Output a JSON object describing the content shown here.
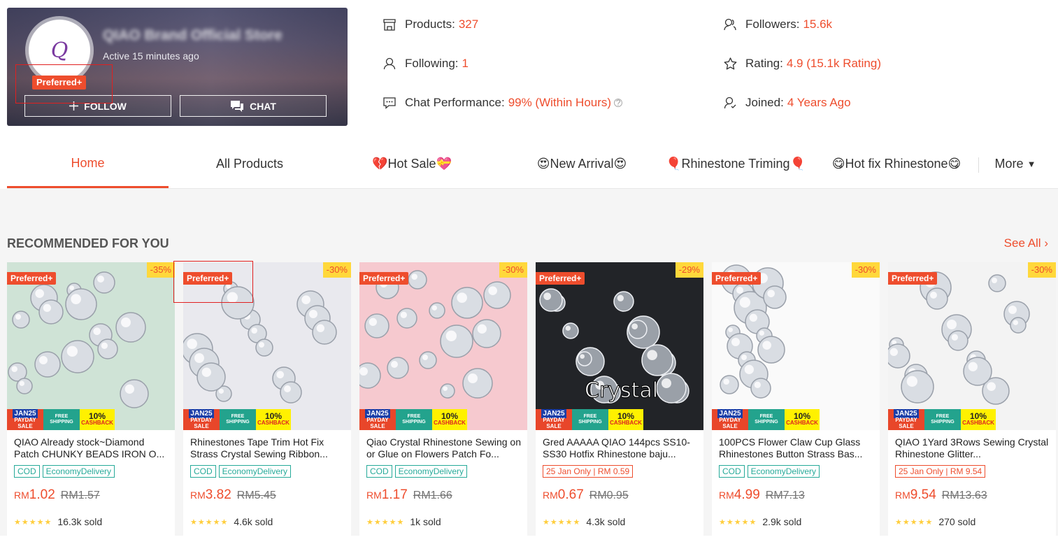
{
  "shop": {
    "name": "QIAO Brand Official Store",
    "active": "Active 15 minutes ago",
    "badge": "Preferred+",
    "follow_label": "FOLLOW",
    "chat_label": "CHAT"
  },
  "stats": {
    "products": {
      "label": "Products:",
      "value": "327",
      "icon": "store-icon"
    },
    "following": {
      "label": "Following:",
      "value": "1",
      "icon": "person-icon"
    },
    "chat_perf": {
      "label": "Chat Performance:",
      "value": "99% (Within Hours)",
      "icon": "chat-bubble-icon"
    },
    "followers": {
      "label": "Followers:",
      "value": "15.6k",
      "icon": "followers-icon"
    },
    "rating": {
      "label": "Rating:",
      "value": "4.9 (15.1k Rating)",
      "icon": "star-icon"
    },
    "joined": {
      "label": "Joined:",
      "value": "4 Years Ago",
      "icon": "person-check-icon"
    }
  },
  "nav": {
    "tabs": [
      {
        "label": "Home"
      },
      {
        "label": "All Products"
      },
      {
        "label": "💔Hot Sale💝"
      },
      {
        "label": "😍New Arrival😍"
      },
      {
        "label": "🎈Rhinestone Triming🎈"
      },
      {
        "label": "😋Hot fix Rhinestone😋"
      }
    ],
    "more_label": "More"
  },
  "section": {
    "title": "RECOMMENDED FOR YOU",
    "see_all": "See All"
  },
  "promo": {
    "jan": "JAN25",
    "payday": "PAYDAY SALE",
    "shipping": "FREE SHIPPING",
    "cashback_pct": "10%",
    "cashback": "CASHBACK"
  },
  "products": [
    {
      "title": "QIAO Already stock~Diamond Patch CHUNKY BEADS IRON O...",
      "badge": "Preferred+",
      "discount": "-35%",
      "chips": [
        "COD",
        "EconomyDelivery"
      ],
      "currency": "RM",
      "price": "1.02",
      "old_price": "RM1.57",
      "sold": "16.3k sold",
      "accent": "#cfe3d6"
    },
    {
      "title": "Rhinestones Tape Trim Hot Fix Strass Crystal Sewing Ribbon...",
      "badge": "Preferred+",
      "discount": "-30%",
      "chips": [
        "COD",
        "EconomyDelivery"
      ],
      "currency": "RM",
      "price": "3.82",
      "old_price": "RM5.45",
      "sold": "4.6k sold",
      "accent": "#e9e9ee"
    },
    {
      "title": "Qiao Crystal Rhinestone Sewing on or Glue on Flowers Patch Fo...",
      "badge": "Preferred+",
      "discount": "-30%",
      "chips": [
        "COD",
        "EconomyDelivery"
      ],
      "currency": "RM",
      "price": "1.17",
      "old_price": "RM1.66",
      "sold": "1k sold",
      "accent": "#f6c9cf"
    },
    {
      "title": "Gred AAAAA QIAO 144pcs SS10-SS30 Hotfix Rhinestone baju...",
      "badge": "Preferred+",
      "discount": "-29%",
      "chips": [
        "25 Jan Only | RM 0.59"
      ],
      "chip_red": true,
      "currency": "RM",
      "price": "0.67",
      "old_price": "RM0.95",
      "sold": "4.3k sold",
      "overlay": "Crystal",
      "accent": "#222428"
    },
    {
      "title": "100PCS Flower Claw Cup Glass Rhinestones Button Strass Bas...",
      "badge": "Preferred+",
      "discount": "-30%",
      "chips": [
        "COD",
        "EconomyDelivery"
      ],
      "currency": "RM",
      "price": "4.99",
      "old_price": "RM7.13",
      "sold": "2.9k sold",
      "accent": "#fafafa"
    },
    {
      "title": "QIAO 1Yard 3Rows Sewing Crystal Rhinestone Glitter...",
      "badge": "Preferred+",
      "discount": "-30%",
      "chips": [
        "25 Jan Only | RM 9.54"
      ],
      "chip_red": true,
      "currency": "RM",
      "price": "9.54",
      "old_price": "RM13.63",
      "sold": "270 sold",
      "accent": "#f3f3f3"
    }
  ],
  "colors": {
    "brand": "#ee4d2d",
    "teal": "#26aa99",
    "star": "#ffce3d"
  }
}
